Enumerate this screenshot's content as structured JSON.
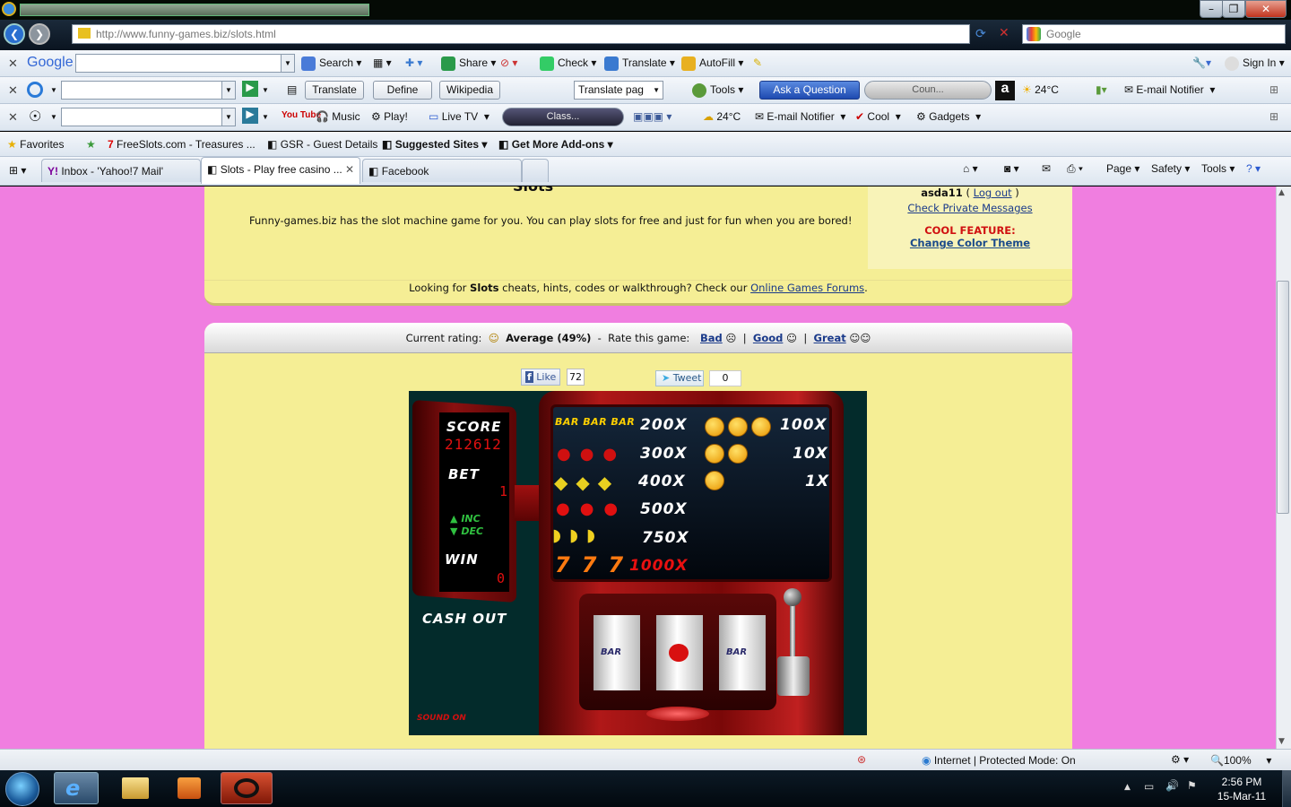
{
  "browser": {
    "url": "http://www.funny-games.biz/slots.html",
    "search_placeholder": "Google",
    "google_toolbar": {
      "brand": "Google",
      "search": "Search",
      "share": "Share",
      "check": "Check",
      "translate": "Translate",
      "autofill": "AutoFill",
      "signin": "Sign In"
    },
    "toolbar2": {
      "translate_btn": "Translate",
      "define_btn": "Define",
      "wikipedia_btn": "Wikipedia",
      "translate_select": "Translate pag",
      "tools": "Tools",
      "ask": "Ask a Question",
      "country": "Coun...",
      "weather": "24°C",
      "email": "E-mail Notifier"
    },
    "toolbar3": {
      "youtube": "You Tube",
      "music": "Music",
      "play": "Play!",
      "livetv": "Live TV",
      "classic": "Class...",
      "weather": "24°C",
      "email": "E-mail Notifier",
      "cool": "Cool",
      "gadgets": "Gadgets"
    },
    "favorites": {
      "label": "Favorites",
      "items": [
        "FreeSlots.com - Treasures ...",
        "GSR - Guest Details",
        "Suggested Sites",
        "Get More Add-ons"
      ]
    },
    "tabs": [
      {
        "label": "Inbox - 'Yahoo!7 Mail'"
      },
      {
        "label": "Slots - Play free casino ..."
      },
      {
        "label": "Facebook"
      }
    ],
    "command_bar": {
      "page": "Page",
      "safety": "Safety",
      "tools": "Tools"
    }
  },
  "page": {
    "heading": "Slots",
    "intro": "Funny-games.biz has the slot machine game for you. You can play slots for free and just for fun when you are bored!",
    "user": "asda11",
    "logout": "Log out",
    "private_messages": "Check Private Messages",
    "cool_feature": "COOL FEATURE:",
    "color_theme": "Change Color Theme",
    "forum_prefix": "Looking for",
    "forum_game": "Slots",
    "forum_mid": "cheats, hints, codes or walkthrough? Check our",
    "forum_link": "Online Games Forums",
    "rating_label": "Current rating:",
    "rating_value": "Average (49%)",
    "rate_label": "Rate this game:",
    "rate_bad": "Bad",
    "rate_good": "Good",
    "rate_great": "Great",
    "like": "Like",
    "like_count": "72",
    "tweet": "Tweet",
    "tweet_count": "0"
  },
  "game": {
    "score_label": "SCORE",
    "score_value": "212612",
    "bet_label": "BET",
    "bet_value": "1",
    "inc": "INC",
    "dec": "DEC",
    "win_label": "WIN",
    "win_value": "0",
    "cash_out": "CASH OUT",
    "sound": "SOUND ON",
    "paytable": [
      {
        "symbols": "BAR BAR BAR",
        "mult": "200X"
      },
      {
        "symbols": "cherries",
        "mult": "300X"
      },
      {
        "symbols": "pears",
        "mult": "400X"
      },
      {
        "symbols": "apples",
        "mult": "500X"
      },
      {
        "symbols": "bananas",
        "mult": "750X"
      },
      {
        "symbols": "7 7 7",
        "mult": "1000X"
      }
    ],
    "smiley_pays": [
      "100X",
      "10X",
      "1X"
    ]
  },
  "status": {
    "zone": "Internet | Protected Mode: On",
    "zoom": "100%"
  },
  "taskbar": {
    "time": "2:56 PM",
    "date": "15-Mar-11"
  },
  "colors": {
    "page_bg": "#f07ee0",
    "panel": "#f5ee95",
    "link": "#1a3a8a",
    "accent_red": "#cc1111"
  }
}
